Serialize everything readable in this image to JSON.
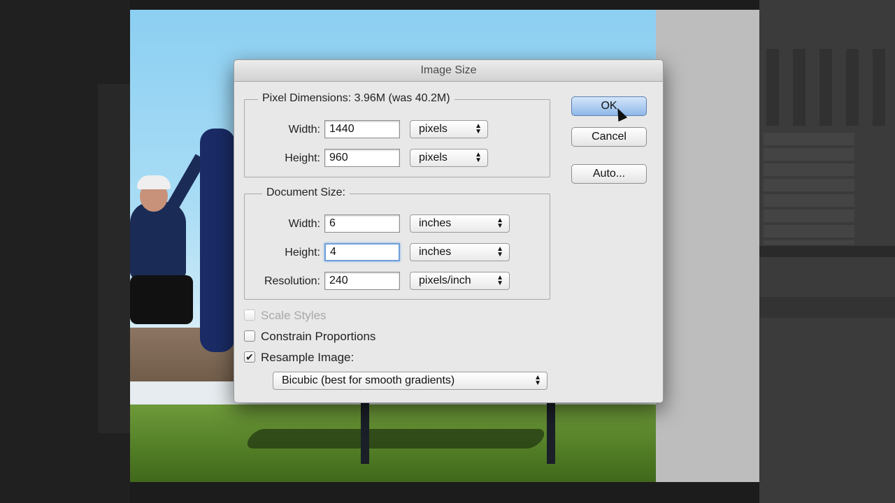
{
  "dialog": {
    "title": "Image Size",
    "pixel_dimensions": {
      "legend": "Pixel Dimensions:  3.96M (was 40.2M)",
      "width_label": "Width:",
      "width_value": "1440",
      "width_unit": "pixels",
      "height_label": "Height:",
      "height_value": "960",
      "height_unit": "pixels"
    },
    "document_size": {
      "legend": "Document Size:",
      "width_label": "Width:",
      "width_value": "6",
      "width_unit": "inches",
      "height_label": "Height:",
      "height_value": "4",
      "height_unit": "inches",
      "resolution_label": "Resolution:",
      "resolution_value": "240",
      "resolution_unit": "pixels/inch"
    },
    "options": {
      "scale_styles": {
        "label": "Scale Styles",
        "checked": false,
        "enabled": false
      },
      "constrain_proportions": {
        "label": "Constrain Proportions",
        "checked": false,
        "enabled": true
      },
      "resample_image": {
        "label": "Resample Image:",
        "checked": true,
        "enabled": true
      },
      "resample_method": "Bicubic (best for smooth gradients)"
    },
    "buttons": {
      "ok": "OK",
      "cancel": "Cancel",
      "auto": "Auto..."
    }
  },
  "icons": {
    "popup_arrows": "updown-chevron-icon",
    "checkmark": "checkmark-icon",
    "pointer": "mouse-pointer-icon"
  },
  "colors": {
    "default_button": "#8fb8e8",
    "focus_ring": "#6f9fd8"
  }
}
